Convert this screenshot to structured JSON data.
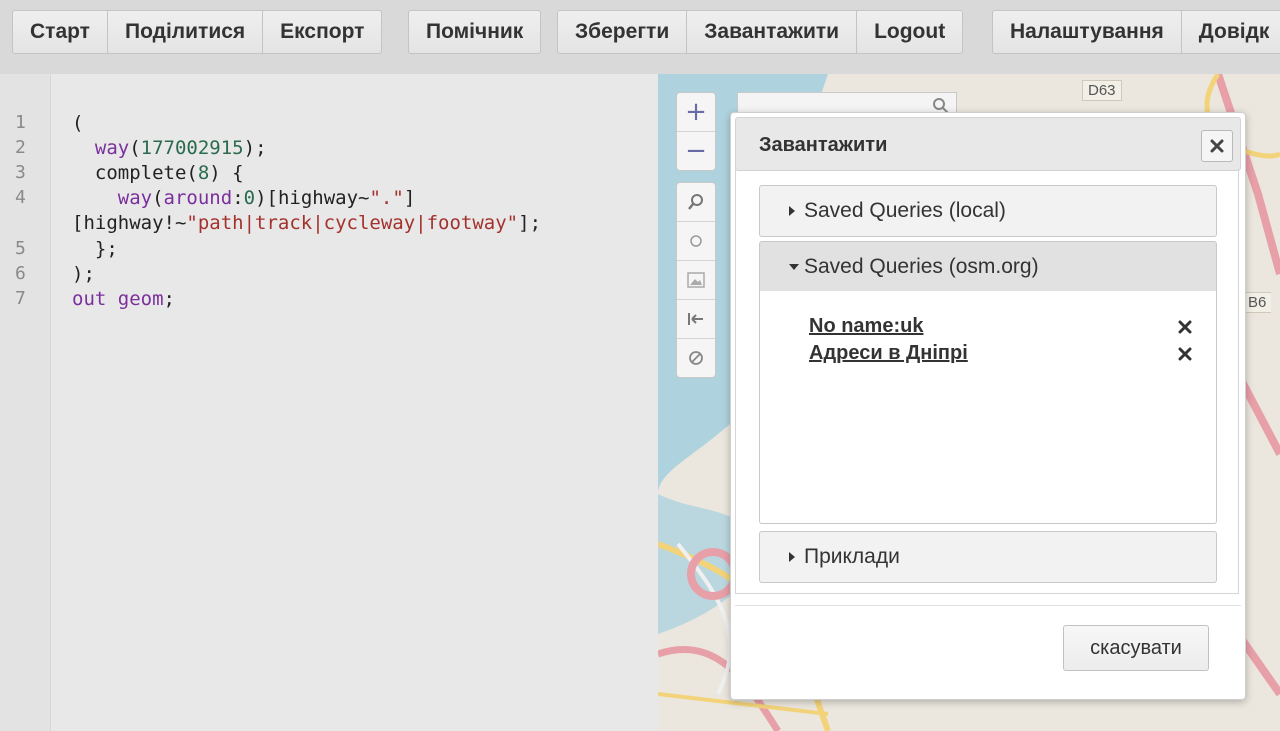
{
  "toolbar": {
    "start": "Старт",
    "share": "Поділитися",
    "export": "Експорт",
    "assistant": "Помічник",
    "save": "Зберегти",
    "load": "Завантажити",
    "logout": "Logout",
    "settings": "Налаштування",
    "help": "Довідк"
  },
  "editor": {
    "line_numbers": [
      "1",
      "2",
      "3",
      "4",
      "5",
      "6",
      "7"
    ]
  },
  "map": {
    "labels": [
      "D63",
      "B6"
    ],
    "zoom_in": "+",
    "zoom_out": "−",
    "tools": [
      "zoom-to-data-icon",
      "locate-icon",
      "image-export-icon",
      "fit-bounds-icon",
      "clear-icon"
    ]
  },
  "modal": {
    "title": "Завантажити",
    "sections": {
      "local": "Saved Queries (local)",
      "osm": "Saved Queries (osm.org)",
      "examples": "Приклади"
    },
    "queries": [
      "No name:uk",
      "Адреси в Дніпрі"
    ],
    "cancel": "скасувати"
  },
  "colors": {
    "keyword": "#7a2f9c",
    "number": "#2a6b4f",
    "string": "#a4322c",
    "zoom_glyph": "#6a6aa8"
  }
}
